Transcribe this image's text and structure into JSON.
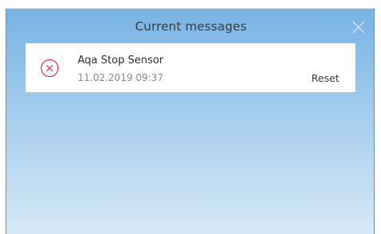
{
  "dialog": {
    "title": "Current messages",
    "close_icon": "close-icon"
  },
  "messages": [
    {
      "icon": "error-circle-x-icon",
      "title": "Aqa Stop Sensor",
      "timestamp": "11.02.2019 09:37",
      "action_label": "Reset"
    }
  ],
  "colors": {
    "gradient_top": "#77b3e3",
    "gradient_bottom": "#d6e9f8",
    "error_icon": "#e2344a",
    "card_bg": "#ffffff"
  }
}
